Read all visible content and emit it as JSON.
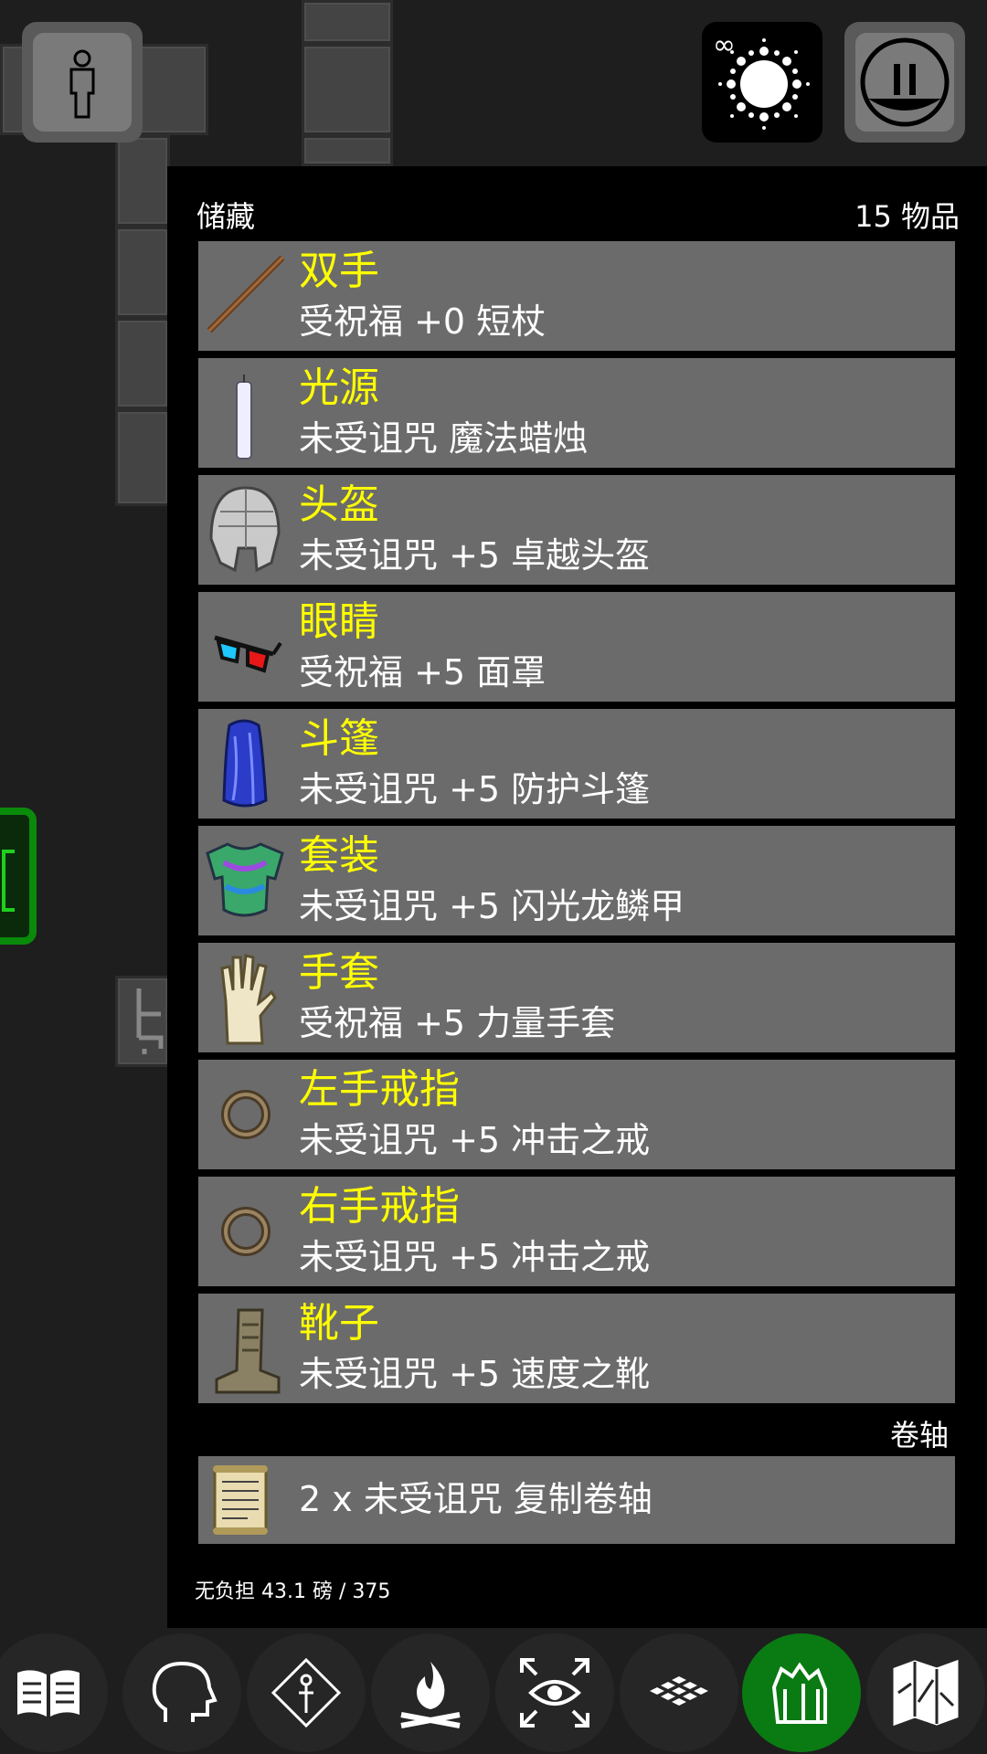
{
  "panel": {
    "title": "储藏",
    "count": "15 物品"
  },
  "equipment": [
    {
      "slot": "双手",
      "desc": "受祝福 +0 短杖",
      "icon": "staff-icon"
    },
    {
      "slot": "光源",
      "desc": "未受诅咒 魔法蜡烛",
      "icon": "candle-icon"
    },
    {
      "slot": "头盔",
      "desc": "未受诅咒 +5 卓越头盔",
      "icon": "helmet-icon"
    },
    {
      "slot": "眼睛",
      "desc": "受祝福 +5 面罩",
      "icon": "glasses-icon"
    },
    {
      "slot": "斗篷",
      "desc": "未受诅咒 +5 防护斗篷",
      "icon": "cloak-icon"
    },
    {
      "slot": "套装",
      "desc": "未受诅咒 +5 闪光龙鳞甲",
      "icon": "armor-icon"
    },
    {
      "slot": "手套",
      "desc": "受祝福 +5 力量手套",
      "icon": "glove-icon"
    },
    {
      "slot": "左手戒指",
      "desc": "未受诅咒 +5 冲击之戒",
      "icon": "ring-icon"
    },
    {
      "slot": "右手戒指",
      "desc": "未受诅咒 +5 冲击之戒",
      "icon": "ring-icon"
    },
    {
      "slot": "靴子",
      "desc": "未受诅咒 +5 速度之靴",
      "icon": "boots-icon"
    }
  ],
  "scrolls": {
    "label": "卷轴",
    "items": [
      {
        "desc": "2 x 未受诅咒 复制卷轴",
        "icon": "scroll-icon"
      }
    ]
  },
  "weight_status": "无负担 43.1 磅 / 375",
  "top_bar": {
    "infinity_text": "∞",
    "icons": [
      "character-icon",
      "magic-burst-icon",
      "pause-icon"
    ]
  },
  "bottom_nav": {
    "icons": [
      "journal-icon",
      "head-icon",
      "spell-icon",
      "campfire-icon",
      "look-icon",
      "floor-icon",
      "inventory-icon",
      "map-icon"
    ],
    "active": "inventory-icon"
  },
  "colors": {
    "slot_text": "#ffff00",
    "row_bg": "#6b6b6b",
    "active_nav": "#0a7a12"
  }
}
